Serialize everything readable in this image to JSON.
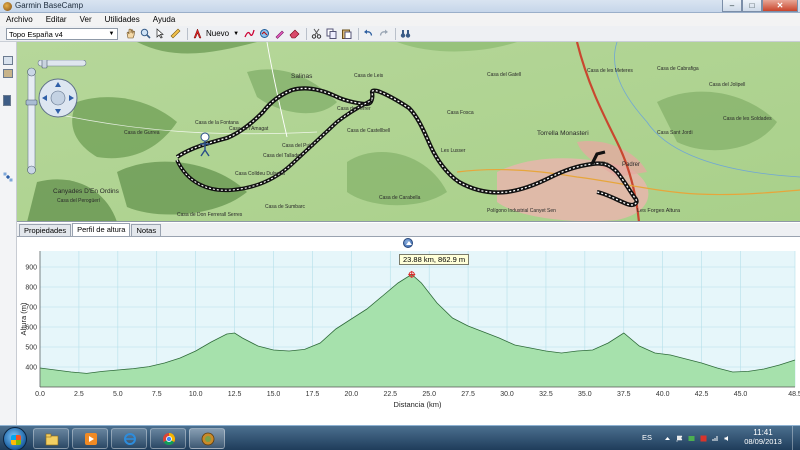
{
  "window": {
    "title": "Garmin BaseCamp",
    "minimize_label": "–",
    "maximize_label": "□",
    "close_label": "✕"
  },
  "menu": {
    "items": [
      {
        "label": "Archivo"
      },
      {
        "label": "Editar"
      },
      {
        "label": "Ver"
      },
      {
        "label": "Utilidades"
      },
      {
        "label": "Ayuda"
      }
    ]
  },
  "toolbar": {
    "map_product": "Topo España v4",
    "new_label": "Nuevo",
    "icons": [
      "hand-tool-icon",
      "zoom-tool-icon",
      "select-arrow-icon",
      "measure-icon",
      "new-waypoint-icon",
      "route-icon",
      "track-icon",
      "eraser-icon",
      "cut-icon",
      "copy-icon",
      "paste-icon",
      "undo-icon",
      "redo-icon",
      "binoculars-icon"
    ]
  },
  "map": {
    "place_labels": [
      {
        "text": "Salinas"
      },
      {
        "text": "Torrella Monasteri"
      },
      {
        "text": "Canyades D'En Ordins"
      },
      {
        "text": "Casa de la Fontana"
      },
      {
        "text": "Casa del Perogüerí"
      },
      {
        "text": "Casa de Gurrea"
      },
      {
        "text": "Casa de l'Amagat"
      },
      {
        "text": "Casa Colldeu Dulsena"
      },
      {
        "text": "Casa del Pujol"
      },
      {
        "text": "Casa del Tallador"
      },
      {
        "text": "Casa de Castellbell"
      },
      {
        "text": "Casa de Ferrer"
      },
      {
        "text": "Casa Fosca"
      },
      {
        "text": "Casa de Leis"
      },
      {
        "text": "Casa de Don Ferrerall Serres"
      },
      {
        "text": "Casa de Sumbarc"
      },
      {
        "text": "Casa de Carabella"
      },
      {
        "text": "Polígono Industrial Canyet Sen"
      },
      {
        "text": "Eix"
      },
      {
        "text": "Padrer"
      },
      {
        "text": "Les Forges Altura"
      },
      {
        "text": "Casa del Gatell"
      },
      {
        "text": "Les Lusser"
      },
      {
        "text": "Casa de Cabrafiga"
      },
      {
        "text": "Casa del Jolipell"
      },
      {
        "text": "Casa de les Meteres"
      },
      {
        "text": "Casa Sant Jordi"
      },
      {
        "text": "Casa de les Soldades"
      }
    ]
  },
  "tabs": [
    {
      "label": "Propiedades",
      "active": false
    },
    {
      "label": "Perfil de altura",
      "active": true
    },
    {
      "label": "Notas",
      "active": false
    }
  ],
  "chart_data": {
    "type": "area",
    "title": "",
    "xlabel": "Distancia   (km)",
    "ylabel": "Altura (m)",
    "xlim": [
      0,
      48.5
    ],
    "ylim": [
      300,
      980
    ],
    "x_ticks": [
      "0.0",
      "2.5",
      "5.0",
      "7.5",
      "10.0",
      "12.5",
      "15.0",
      "17.5",
      "20.0",
      "22.5",
      "25.0",
      "27.5",
      "30.0",
      "32.5",
      "35.0",
      "37.5",
      "40.0",
      "42.5",
      "45.0",
      "48.5"
    ],
    "y_ticks": [
      "400",
      "500",
      "600",
      "700",
      "800",
      "900"
    ],
    "grid": true,
    "tooltip": "23.88 km, 862.9 m",
    "peak": {
      "x": 23.88,
      "y": 862.9
    },
    "series": [
      {
        "x": [
          0,
          1,
          2,
          3,
          4,
          5,
          6,
          7,
          8,
          9,
          10,
          11,
          12,
          12.5,
          13,
          14,
          15,
          16,
          17,
          18,
          19,
          20,
          21,
          22,
          23,
          23.88,
          24.5,
          25.5,
          26.5,
          27.5,
          28.5,
          29.5,
          30.5,
          31.5,
          32.5,
          33.5,
          34.5,
          35.5,
          36.5,
          37.5,
          38.5,
          39.5,
          40.5,
          41.5,
          42.5,
          43.5,
          44.5,
          45.5,
          46.5,
          47.5,
          48.5
        ],
        "values": [
          395,
          385,
          375,
          368,
          378,
          385,
          392,
          402,
          420,
          445,
          480,
          525,
          565,
          570,
          545,
          505,
          485,
          480,
          488,
          520,
          590,
          640,
          690,
          755,
          820,
          862.9,
          820,
          720,
          645,
          605,
          575,
          545,
          510,
          495,
          480,
          470,
          480,
          485,
          520,
          570,
          505,
          470,
          460,
          440,
          420,
          395,
          375,
          378,
          390,
          410,
          435
        ]
      }
    ]
  },
  "taskbar": {
    "language": "ES",
    "time": "11:41",
    "date": "08/09/2013",
    "pinned": [
      "windows-explorer-icon",
      "media-player-icon",
      "internet-explorer-icon",
      "chrome-icon",
      "basecamp-icon"
    ]
  }
}
